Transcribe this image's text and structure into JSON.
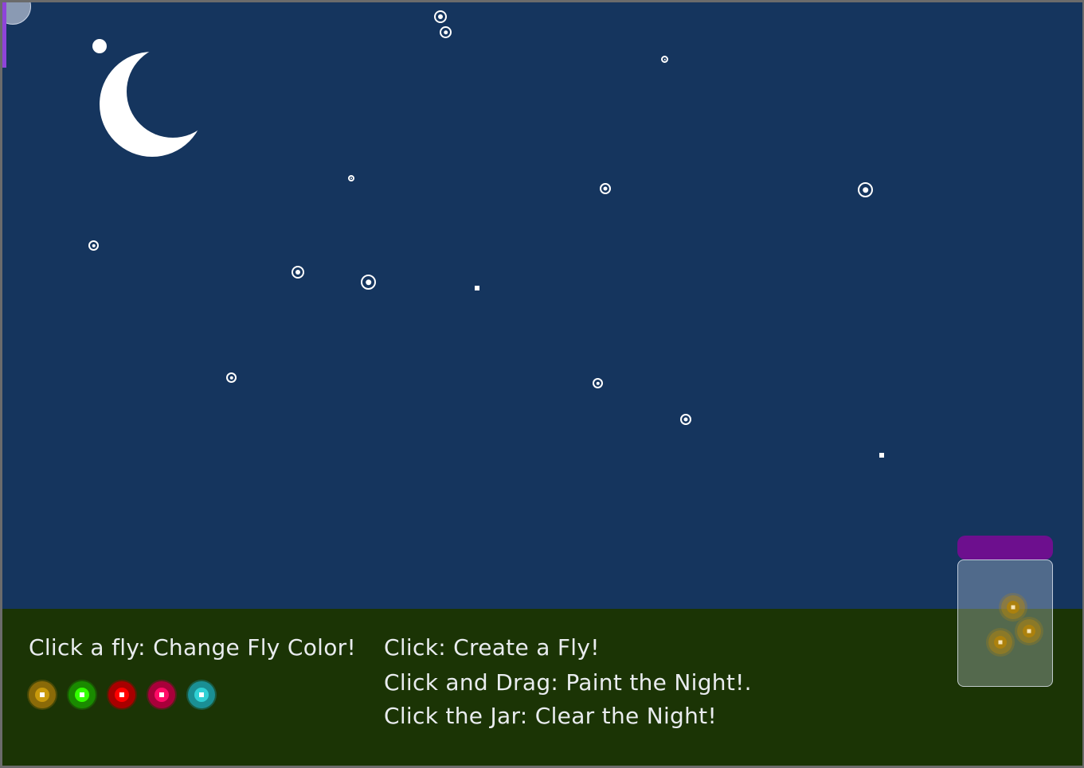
{
  "instructions": {
    "fly_hint": "Click a fly: Change Fly Color!",
    "click_hint": "Click: Create a Fly!",
    "drag_hint": "Click and Drag: Paint the Night!.",
    "jar_hint": "Click the Jar: Clear the Night!"
  },
  "colors": {
    "sky": "#15355e",
    "ground": "#1b3405",
    "jar_lid": "#6d0f8e",
    "moon": "#ffffff",
    "text": "#e9ecef"
  },
  "fly_colors": [
    {
      "name": "gold",
      "outer": "#8a6a08",
      "core": "#c99a0c"
    },
    {
      "name": "green",
      "outer": "#1a8a00",
      "core": "#33ff00"
    },
    {
      "name": "red",
      "outer": "#a80000",
      "core": "#ff0000"
    },
    {
      "name": "pink",
      "outer": "#a8003a",
      "core": "#ff0b66"
    },
    {
      "name": "cyan",
      "outer": "#1a8f94",
      "core": "#2fd0d4"
    }
  ],
  "jar": {
    "fly_count": 3
  }
}
